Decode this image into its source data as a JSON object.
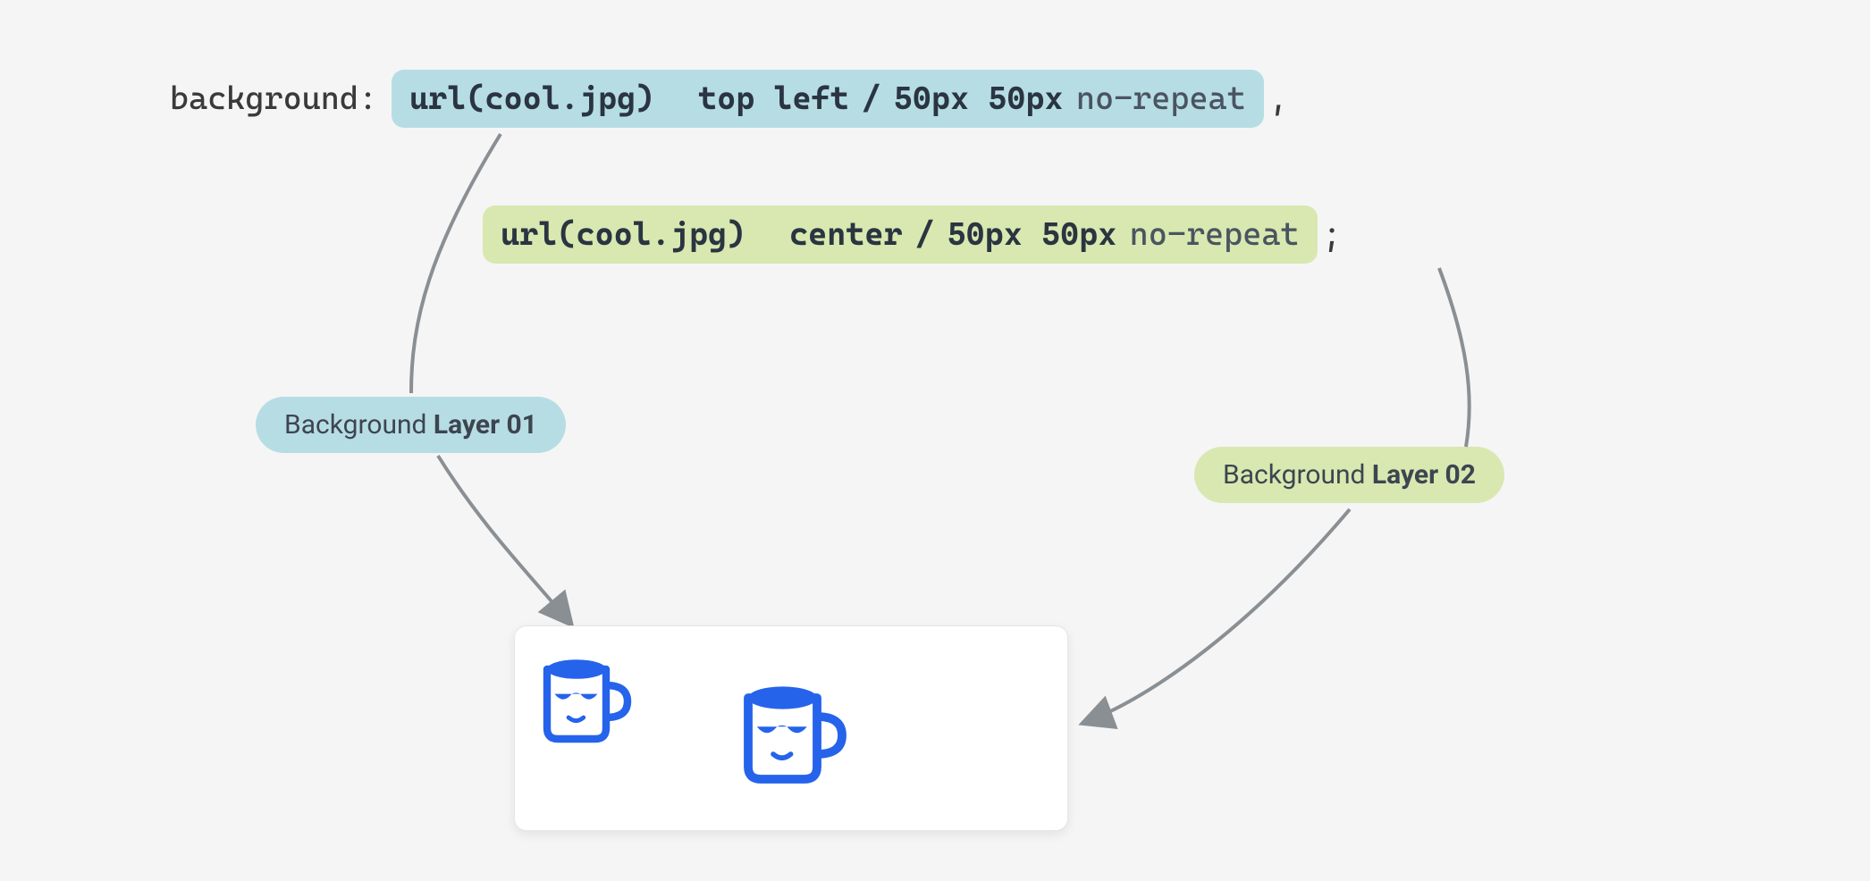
{
  "css": {
    "property": "background:",
    "layer1": {
      "url": "url(cool.jpg)",
      "position": "top left",
      "sep": "/",
      "size": "50px 50px",
      "repeat": "no-repeat",
      "punct": ","
    },
    "layer2": {
      "url": "url(cool.jpg)",
      "position": "center",
      "sep": "/",
      "size": "50px 50px",
      "repeat": "no-repeat",
      "punct": ";"
    }
  },
  "labels": {
    "layer1_prefix": "Background ",
    "layer1_bold": "Layer 01",
    "layer2_prefix": "Background ",
    "layer2_bold": "Layer 02"
  },
  "colors": {
    "blue": "#b7dde4",
    "green": "#d8e8b0",
    "mug": "#2563eb",
    "arrow": "#8a8f94"
  }
}
